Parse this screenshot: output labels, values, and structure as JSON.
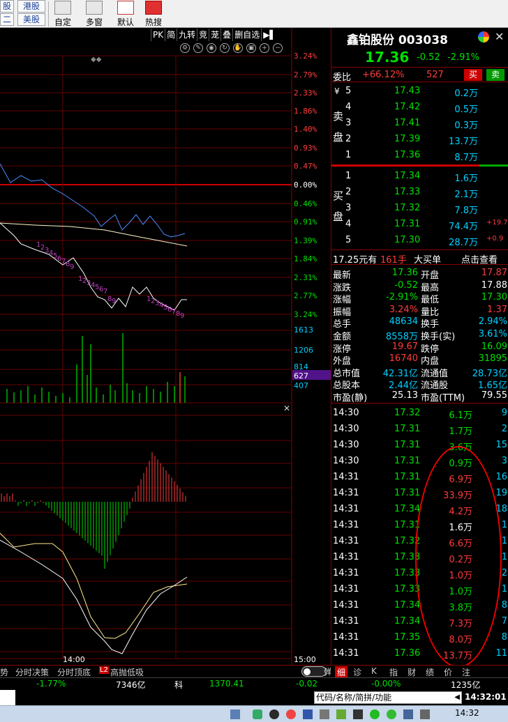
{
  "toolbar": {
    "btn_top_left_1": "股",
    "btn_top_left_2": "二",
    "btn_hk": "港股",
    "btn_us": "美股",
    "btn_custom": "自定",
    "btn_multi": "多窗",
    "btn_default": "默认",
    "btn_hot": "热搜"
  },
  "chart": {
    "toolbar_items": [
      "PK",
      "简",
      "九转",
      "竞",
      "茏",
      "叠",
      "删自选",
      "▶▌"
    ],
    "pct_labels": [
      "3.24%",
      "2.79%",
      "2.33%",
      "1.86%",
      "1.40%",
      "0.93%",
      "0.47%",
      "0.00%",
      "0.46%",
      "0.91%",
      "1.39%",
      "1.84%",
      "2.31%",
      "2.77%",
      "3.24%"
    ],
    "vol_labels": [
      "1613",
      "1206",
      "814",
      "627",
      "407"
    ],
    "time_mid": "14:00",
    "time_end": "15:00",
    "seq_upper": "1 2 3 4 5 6 7 8 9",
    "seq_lower1": "1 2 3 4 5 6 7 8 9",
    "seq_lower2": "1 2 3 4 5 6 7 8 9"
  },
  "right": {
    "stock_name": "鑫铂股份",
    "stock_code": "003038",
    "price": "17.36",
    "change": "-0.52",
    "change_pct": "-2.91%",
    "commission_label": "委比",
    "commission_pct": "+66.12%",
    "commission_val": "527",
    "buy_btn": "买",
    "sell_btn": "卖",
    "sell_label": "卖盘",
    "buy_label": "买盘",
    "yen": "¥",
    "sell_orders": [
      {
        "lvl": "5",
        "price": "17.43",
        "vol": "0.2万"
      },
      {
        "lvl": "4",
        "price": "17.42",
        "vol": "0.5万"
      },
      {
        "lvl": "3",
        "price": "17.41",
        "vol": "0.3万"
      },
      {
        "lvl": "2",
        "price": "17.39",
        "vol": "13.7万"
      },
      {
        "lvl": "1",
        "price": "17.36",
        "vol": "8.7万"
      }
    ],
    "buy_orders": [
      {
        "lvl": "1",
        "price": "17.34",
        "vol": "1.6万",
        "extra": ""
      },
      {
        "lvl": "2",
        "price": "17.33",
        "vol": "2.1万",
        "extra": ""
      },
      {
        "lvl": "3",
        "price": "17.32",
        "vol": "7.8万",
        "extra": ""
      },
      {
        "lvl": "4",
        "price": "17.31",
        "vol": "74.4万",
        "extra": "+19.7"
      },
      {
        "lvl": "5",
        "price": "17.30",
        "vol": "28.7万",
        "extra": "+0.9"
      }
    ],
    "bigorder": {
      "amount": "17.25元有",
      "hands": "161手",
      "label": "大买单",
      "link": "点击查看"
    },
    "stats": [
      {
        "l1": "最新",
        "v1": "17.36",
        "l2": "开盘",
        "v2": "17.87"
      },
      {
        "l1": "涨跌",
        "v1": "-0.52",
        "l2": "最高",
        "v2": "17.88"
      },
      {
        "l1": "涨幅",
        "v1": "-2.91%",
        "l2": "最低",
        "v2": "17.30"
      },
      {
        "l1": "振幅",
        "v1": "3.24%",
        "l2": "量比",
        "v2": "1.37"
      },
      {
        "l1": "总手",
        "v1": "48634",
        "l2": "换手",
        "v2": "2.94%"
      },
      {
        "l1": "金额",
        "v1": "8558万",
        "l2": "换手(实)",
        "v2": "3.61%"
      },
      {
        "l1": "涨停",
        "v1": "19.67",
        "l2": "跌停",
        "v2": "16.09"
      },
      {
        "l1": "外盘",
        "v1": "16740",
        "l2": "内盘",
        "v2": "31895"
      },
      {
        "l1": "总市值",
        "v1": "42.31亿",
        "l2": "流通值",
        "v2": "28.73亿"
      },
      {
        "l1": "总股本",
        "v1": "2.44亿",
        "l2": "流通股",
        "v2": "1.65亿"
      },
      {
        "l1": "市盈(静)",
        "v1": "25.13",
        "l2": "市盈(TTM)",
        "v2": "79.55"
      }
    ],
    "ticks": [
      {
        "t": "14:30",
        "p": "17.32",
        "v": "6.1万",
        "n": "9"
      },
      {
        "t": "14:30",
        "p": "17.31",
        "v": "1.7万",
        "n": "2"
      },
      {
        "t": "14:30",
        "p": "17.31",
        "v": "3.6万",
        "n": "15"
      },
      {
        "t": "14:30",
        "p": "17.31",
        "v": "0.9万",
        "n": "3"
      },
      {
        "t": "14:31",
        "p": "17.31",
        "v": "6.9万",
        "n": "16"
      },
      {
        "t": "14:31",
        "p": "17.31",
        "v": "33.9万",
        "n": "19"
      },
      {
        "t": "14:31",
        "p": "17.34",
        "v": "4.2万",
        "n": "18"
      },
      {
        "t": "14:31",
        "p": "17.31",
        "v": "1.6万",
        "n": "1"
      },
      {
        "t": "14:31",
        "p": "17.32",
        "v": "6.6万",
        "n": "1"
      },
      {
        "t": "14:31",
        "p": "17.33",
        "v": "0.2万",
        "n": "1"
      },
      {
        "t": "14:31",
        "p": "17.33",
        "v": "1.0万",
        "n": "2"
      },
      {
        "t": "14:31",
        "p": "17.33",
        "v": "1.0万",
        "n": "1"
      },
      {
        "t": "14:31",
        "p": "17.34",
        "v": "3.8万",
        "n": "8"
      },
      {
        "t": "14:31",
        "p": "17.34",
        "v": "7.3万",
        "n": "7"
      },
      {
        "t": "14:31",
        "p": "17.35",
        "v": "8.0万",
        "n": "8"
      },
      {
        "t": "14:31",
        "p": "17.36",
        "v": "13.7万",
        "n": "11"
      }
    ]
  },
  "bottom_tabs": [
    "势",
    "分时决策",
    "分时顶底",
    "高抛低吸"
  ],
  "bottom_tab_badge": "L2",
  "toggle_label": "弹",
  "right_tabs": [
    "细",
    "诊",
    "K",
    "指",
    "财",
    "绩",
    "价",
    "注"
  ],
  "status": {
    "pct1": "-1.77%",
    "amount1": "7346亿",
    "sci_label": "科",
    "index_val": "1370.41",
    "idx_change": "-0.02",
    "idx_pct": "-0.00%",
    "amount2": "1235亿"
  },
  "bottom": {
    "search_placeholder": "代码/名称/简拼/功能",
    "clock": "14:32:01"
  },
  "taskbar": {
    "time": "14:32"
  },
  "colors": {
    "up": "#ff3c3c",
    "down": "#00e000",
    "neutral": "#ffffff",
    "yellow": "#ffff00",
    "cyan": "#00d0ff",
    "purple": "#c040c0"
  }
}
